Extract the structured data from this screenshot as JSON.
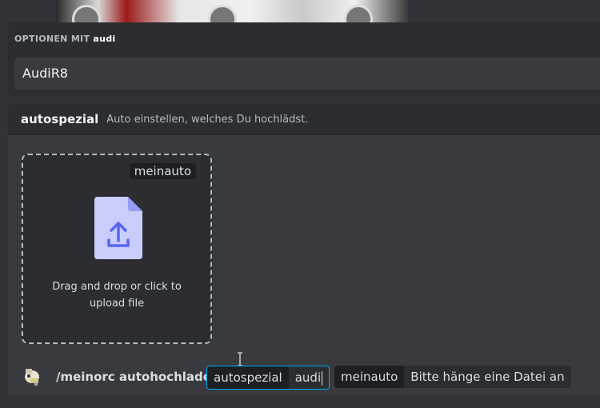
{
  "options": {
    "label_prefix": "OPTIONEN MIT",
    "label_bold": "audi",
    "input_value": "AudiR8"
  },
  "command": {
    "name": "autospezial",
    "description": "Auto einstellen, welches Du hochlädst."
  },
  "dropzone": {
    "option_tag": "meinauto",
    "text": "Drag and drop or click to upload file",
    "icon": "upload-file-icon"
  },
  "chat_bar": {
    "command": "/meinorc autohochladen",
    "pills": [
      {
        "name": "autospezial",
        "value": "audi"
      },
      {
        "name": "meinauto",
        "value": "Bitte hänge eine Datei an"
      }
    ]
  },
  "colors": {
    "background": "#313338",
    "panel": "#2b2d31",
    "accent": "#5865f2",
    "focus": "#00a8fc"
  }
}
